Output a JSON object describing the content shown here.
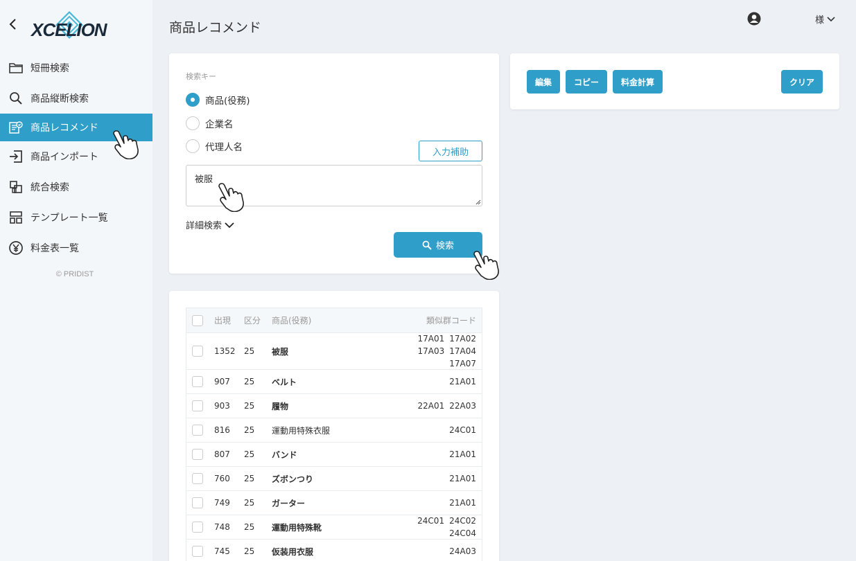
{
  "sidebar": {
    "logo_text": "XCELION",
    "items": [
      {
        "label": "短冊検索",
        "icon": "folder-icon"
      },
      {
        "label": "商品縦断検索",
        "icon": "search-icon"
      },
      {
        "label": "商品レコメンド",
        "icon": "recommend-icon"
      },
      {
        "label": "商品インポート",
        "icon": "import-icon"
      },
      {
        "label": "統合検索",
        "icon": "merge-icon"
      },
      {
        "label": "テンプレート一覧",
        "icon": "template-icon"
      },
      {
        "label": "料金表一覧",
        "icon": "yen-icon"
      }
    ],
    "active_index": 2,
    "copyright": "© PRIDIST"
  },
  "header": {
    "title": "商品レコメンド",
    "user_suffix": "様"
  },
  "search": {
    "field_label": "検索キー",
    "options": [
      "商品(役務)",
      "企業名",
      "代理人名"
    ],
    "selected_index": 0,
    "assist_label": "入力補助",
    "keyword": "被服",
    "detail_label": "詳細検索",
    "search_label": "検索"
  },
  "actions": {
    "edit": "編集",
    "copy": "コピー",
    "calc": "料金計算",
    "clear": "クリア"
  },
  "results": {
    "headers": {
      "count": "出現",
      "category": "区分",
      "name": "商品(役務)",
      "codes": "類似群コード"
    },
    "rows": [
      {
        "count": "1352",
        "category": "25",
        "name": "被服",
        "bold": true,
        "codes": [
          "17A01",
          "17A02",
          "17A03",
          "17A04",
          "17A07"
        ]
      },
      {
        "count": "907",
        "category": "25",
        "name": "ベルト",
        "bold": true,
        "codes": [
          "21A01"
        ]
      },
      {
        "count": "903",
        "category": "25",
        "name": "履物",
        "bold": true,
        "codes": [
          "22A01",
          "22A03"
        ]
      },
      {
        "count": "816",
        "category": "25",
        "name": "運動用特殊衣服",
        "bold": false,
        "codes": [
          "24C01"
        ]
      },
      {
        "count": "807",
        "category": "25",
        "name": "バンド",
        "bold": true,
        "codes": [
          "21A01"
        ]
      },
      {
        "count": "760",
        "category": "25",
        "name": "ズボンつり",
        "bold": true,
        "codes": [
          "21A01"
        ]
      },
      {
        "count": "749",
        "category": "25",
        "name": "ガーター",
        "bold": true,
        "codes": [
          "21A01"
        ]
      },
      {
        "count": "748",
        "category": "25",
        "name": "運動用特殊靴",
        "bold": true,
        "codes": [
          "24C01",
          "24C02",
          "24C04"
        ]
      },
      {
        "count": "745",
        "category": "25",
        "name": "仮装用衣服",
        "bold": true,
        "codes": [
          "24A03"
        ]
      }
    ]
  },
  "colors": {
    "accent": "#2f9ec8",
    "sidebar_bg": "#f4f7fa",
    "page_bg": "#edf1f5"
  }
}
